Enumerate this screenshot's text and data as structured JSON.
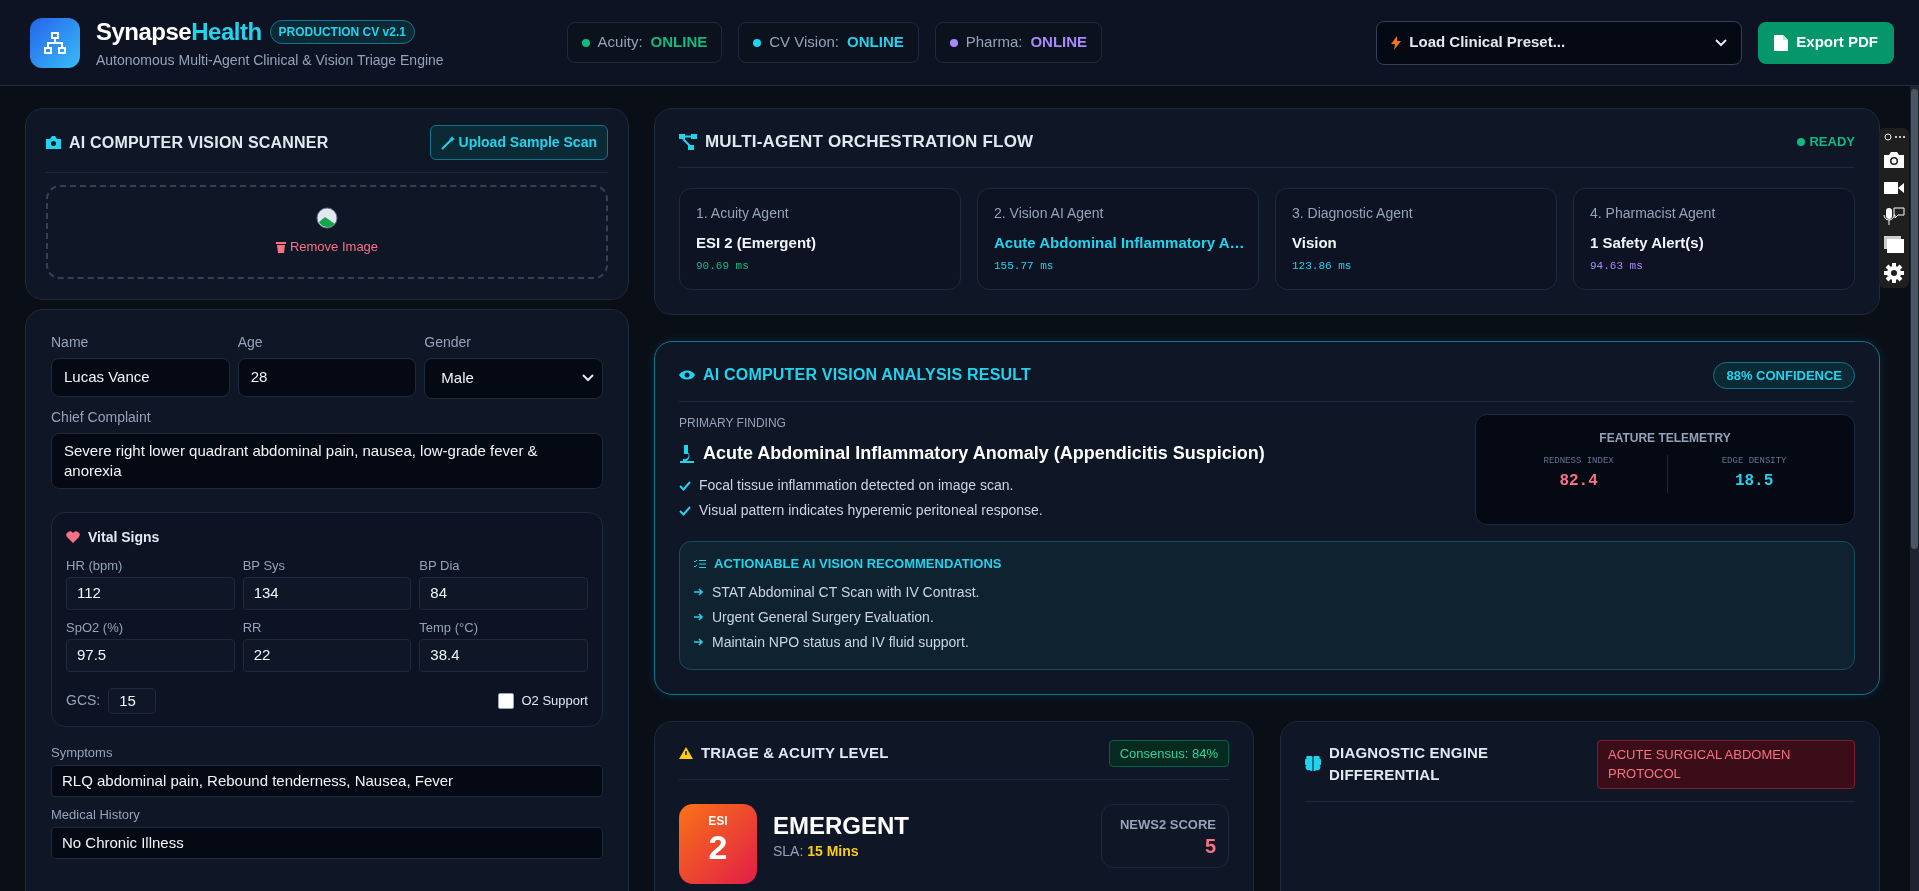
{
  "header": {
    "brand": "Synapse",
    "brand_accent": "Health",
    "version": "PRODUCTION CV v2.1",
    "subtitle": "Autonomous Multi-Agent Clinical & Vision Triage Engine",
    "statuses": [
      {
        "label": "Acuity:",
        "value": "ONLINE",
        "color": "#10b981"
      },
      {
        "label": "CV Vision:",
        "value": "ONLINE",
        "color": "#22d3ee"
      },
      {
        "label": "Pharma:",
        "value": "ONLINE",
        "color": "#a78bfa"
      }
    ],
    "preset_select": {
      "value": "Load Clinical Preset..."
    },
    "export_button": "Export PDF"
  },
  "scanner": {
    "title": "AI COMPUTER VISION SCANNER",
    "upload_button": "Upload Sample Scan",
    "remove_button": "Remove Image"
  },
  "patient": {
    "fields": [
      {
        "label": "Name",
        "value": "Lucas Vance",
        "kind": "input"
      },
      {
        "label": "Age",
        "value": "28",
        "kind": "input"
      },
      {
        "label": "Gender",
        "value": "Male",
        "kind": "select"
      }
    ],
    "chief_complaint": {
      "label": "Chief Complaint",
      "value": "Severe right lower quadrant abdominal pain, nausea, low-grade fever & anorexia"
    },
    "vitals": {
      "title": "Vital Signs",
      "fields": [
        {
          "label": "HR (bpm)",
          "value": "112"
        },
        {
          "label": "BP Sys",
          "value": "134"
        },
        {
          "label": "BP Dia",
          "value": "84"
        },
        {
          "label": "SpO2 (%)",
          "value": "97.5"
        },
        {
          "label": "RR",
          "value": "22"
        },
        {
          "label": "Temp (°C)",
          "value": "38.4"
        }
      ],
      "gcs": {
        "label": "GCS:",
        "value": "15"
      },
      "o2_support": {
        "label": "O2 Support",
        "checked": false
      }
    },
    "symptoms": {
      "label": "Symptoms",
      "value": "RLQ abdominal pain, Rebound tenderness, Nausea, Fever"
    },
    "medical_history": {
      "label": "Medical History",
      "value": "No Chronic Illness"
    }
  },
  "orchestration": {
    "title": "MULTI-AGENT ORCHESTRATION FLOW",
    "status": "READY",
    "agents": [
      {
        "name": "1. Acuity Agent",
        "result": "ESI 2 (Emergent)",
        "latency": "90.69 ms",
        "color": "#10b981",
        "accent": false
      },
      {
        "name": "2. Vision AI Agent",
        "result": "Acute Abdominal Inflammatory A…",
        "latency": "155.77 ms",
        "color": "#22d3ee",
        "accent": true
      },
      {
        "name": "3. Diagnostic Agent",
        "result": "Vision",
        "latency": "123.86 ms",
        "color": "#22d3ee",
        "accent": false
      },
      {
        "name": "4. Pharmacist Agent",
        "result": "1 Safety Alert(s)",
        "latency": "94.63 ms",
        "color": "#a78bfa",
        "accent": false
      }
    ]
  },
  "vision_result": {
    "title": "AI COMPUTER VISION ANALYSIS RESULT",
    "confidence": "88% CONFIDENCE",
    "primary_label": "PRIMARY FINDING",
    "finding": "Acute Abdominal Inflammatory Anomaly (Appendicitis Suspicion)",
    "observations": [
      "Focal tissue inflammation detected on image scan.",
      "Visual pattern indicates hyperemic peritoneal response."
    ],
    "telemetry": {
      "title": "FEATURE TELEMETRY",
      "metrics": [
        {
          "label": "REDNESS INDEX",
          "value": "82.4",
          "color": "#f87185"
        },
        {
          "label": "EDGE DENSITY",
          "value": "18.5",
          "color": "#22d3ee"
        }
      ]
    },
    "recommendations": {
      "title": "ACTIONABLE AI VISION RECOMMENDATIONS",
      "items": [
        "STAT Abdominal CT Scan with IV Contrast.",
        "Urgent General Surgery Evaluation.",
        "Maintain NPO status and IV fluid support."
      ]
    }
  },
  "triage": {
    "title": "TRIAGE & ACUITY LEVEL",
    "consensus": "Consensus: 84%",
    "esi_label": "ESI",
    "esi_level": "2",
    "acuity": "EMERGENT",
    "sla_label": "SLA:",
    "sla_value": "15 Mins",
    "news2_label": "NEWS2 SCORE",
    "news2_value": "5"
  },
  "diagnostic": {
    "title": "DIAGNOSTIC ENGINE DIFFERENTIAL",
    "protocol": "ACUTE SURGICAL ABDOMEN PROTOCOL"
  }
}
